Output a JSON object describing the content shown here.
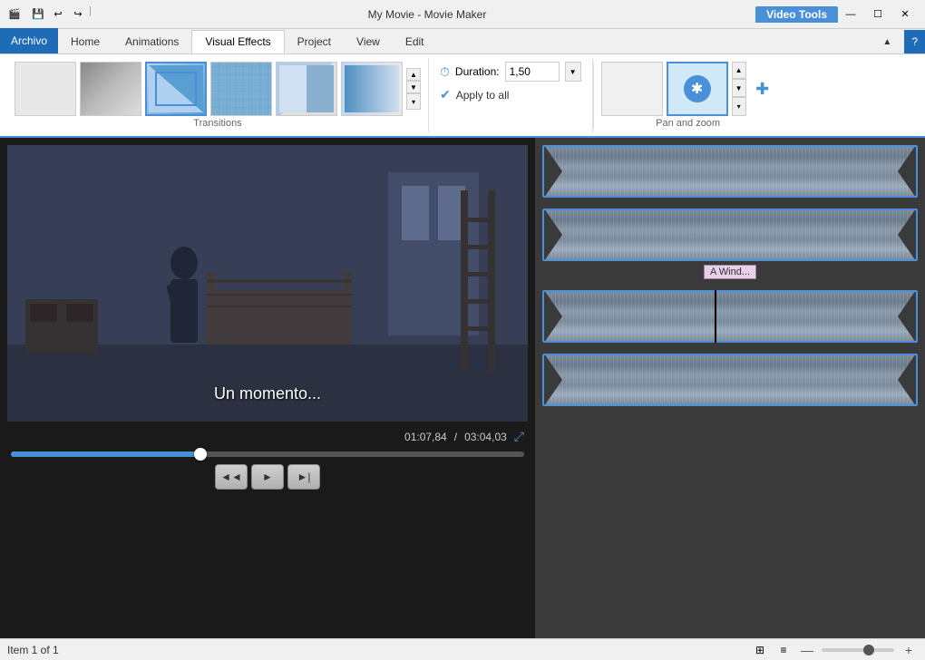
{
  "titlebar": {
    "title": "My Movie - Movie Maker",
    "video_tools_label": "Video Tools",
    "minimize": "—",
    "maximize": "☐",
    "close": "✕"
  },
  "ribbon": {
    "tabs": [
      {
        "id": "archivo",
        "label": "Archivo",
        "active": false,
        "special": "archivo"
      },
      {
        "id": "home",
        "label": "Home",
        "active": false
      },
      {
        "id": "animations",
        "label": "Animations",
        "active": false
      },
      {
        "id": "visual-effects",
        "label": "Visual Effects",
        "active": true
      },
      {
        "id": "project",
        "label": "Project",
        "active": false
      },
      {
        "id": "view",
        "label": "View",
        "active": false
      },
      {
        "id": "edit",
        "label": "Edit",
        "active": false
      }
    ],
    "transitions_label": "Transitions",
    "pan_zoom_label": "Pan and zoom",
    "duration_label": "Duration:",
    "duration_value": "1,50",
    "apply_to_all_label": "Apply to all"
  },
  "preview": {
    "subtitle": "Un momento...",
    "time_current": "01:07,84",
    "time_total": "03:04,03",
    "time_separator": "/"
  },
  "playback": {
    "rewind": "◄◄",
    "play": "►",
    "forward": "►|"
  },
  "timeline": {
    "clips": [
      {
        "id": "clip1",
        "has_label": false
      },
      {
        "id": "clip2",
        "has_label": true,
        "label": "A Wind..."
      },
      {
        "id": "clip3",
        "has_label": false,
        "has_playhead": true
      },
      {
        "id": "clip4",
        "has_label": false
      }
    ]
  },
  "statusbar": {
    "item_info": "Item 1 of 1",
    "zoom_in": "+",
    "zoom_out": "—"
  }
}
